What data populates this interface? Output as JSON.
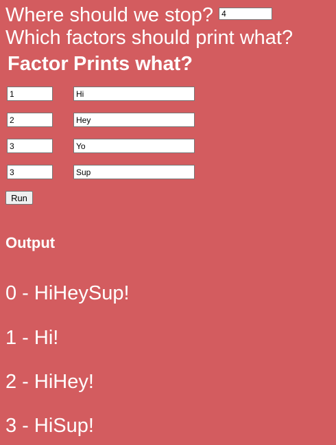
{
  "prompts": {
    "stop_question": "Where should we stop?",
    "factors_question": "Which factors should print what?"
  },
  "stop_input": {
    "value": "4"
  },
  "table": {
    "headers": {
      "factor": "Factor",
      "prints": "Prints what?"
    },
    "rows": [
      {
        "factor": "1",
        "prints": "Hi"
      },
      {
        "factor": "2",
        "prints": "Hey"
      },
      {
        "factor": "3",
        "prints": "Yo"
      },
      {
        "factor": "3",
        "prints": "Sup"
      }
    ]
  },
  "run_button": {
    "label": "Run"
  },
  "output": {
    "heading": "Output",
    "lines": [
      "0 - HiHeySup!",
      "1 - Hi!",
      "2 - HiHey!",
      "3 - HiSup!"
    ]
  },
  "colors": {
    "background": "#d35c5f",
    "text": "#ffffff"
  }
}
